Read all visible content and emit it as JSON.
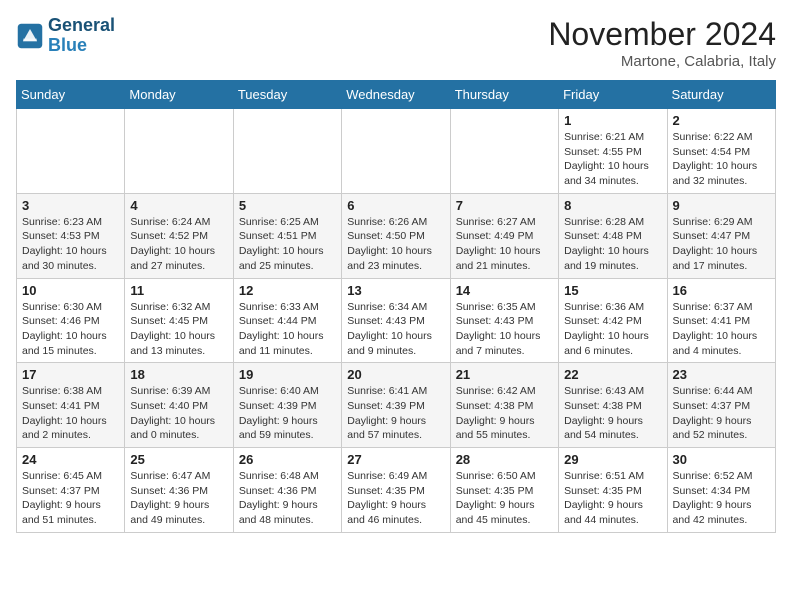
{
  "logo": {
    "line1": "General",
    "line2": "Blue"
  },
  "title": "November 2024",
  "location": "Martone, Calabria, Italy",
  "days_of_week": [
    "Sunday",
    "Monday",
    "Tuesday",
    "Wednesday",
    "Thursday",
    "Friday",
    "Saturday"
  ],
  "weeks": [
    [
      {
        "day": "",
        "info": ""
      },
      {
        "day": "",
        "info": ""
      },
      {
        "day": "",
        "info": ""
      },
      {
        "day": "",
        "info": ""
      },
      {
        "day": "",
        "info": ""
      },
      {
        "day": "1",
        "info": "Sunrise: 6:21 AM\nSunset: 4:55 PM\nDaylight: 10 hours and 34 minutes."
      },
      {
        "day": "2",
        "info": "Sunrise: 6:22 AM\nSunset: 4:54 PM\nDaylight: 10 hours and 32 minutes."
      }
    ],
    [
      {
        "day": "3",
        "info": "Sunrise: 6:23 AM\nSunset: 4:53 PM\nDaylight: 10 hours and 30 minutes."
      },
      {
        "day": "4",
        "info": "Sunrise: 6:24 AM\nSunset: 4:52 PM\nDaylight: 10 hours and 27 minutes."
      },
      {
        "day": "5",
        "info": "Sunrise: 6:25 AM\nSunset: 4:51 PM\nDaylight: 10 hours and 25 minutes."
      },
      {
        "day": "6",
        "info": "Sunrise: 6:26 AM\nSunset: 4:50 PM\nDaylight: 10 hours and 23 minutes."
      },
      {
        "day": "7",
        "info": "Sunrise: 6:27 AM\nSunset: 4:49 PM\nDaylight: 10 hours and 21 minutes."
      },
      {
        "day": "8",
        "info": "Sunrise: 6:28 AM\nSunset: 4:48 PM\nDaylight: 10 hours and 19 minutes."
      },
      {
        "day": "9",
        "info": "Sunrise: 6:29 AM\nSunset: 4:47 PM\nDaylight: 10 hours and 17 minutes."
      }
    ],
    [
      {
        "day": "10",
        "info": "Sunrise: 6:30 AM\nSunset: 4:46 PM\nDaylight: 10 hours and 15 minutes."
      },
      {
        "day": "11",
        "info": "Sunrise: 6:32 AM\nSunset: 4:45 PM\nDaylight: 10 hours and 13 minutes."
      },
      {
        "day": "12",
        "info": "Sunrise: 6:33 AM\nSunset: 4:44 PM\nDaylight: 10 hours and 11 minutes."
      },
      {
        "day": "13",
        "info": "Sunrise: 6:34 AM\nSunset: 4:43 PM\nDaylight: 10 hours and 9 minutes."
      },
      {
        "day": "14",
        "info": "Sunrise: 6:35 AM\nSunset: 4:43 PM\nDaylight: 10 hours and 7 minutes."
      },
      {
        "day": "15",
        "info": "Sunrise: 6:36 AM\nSunset: 4:42 PM\nDaylight: 10 hours and 6 minutes."
      },
      {
        "day": "16",
        "info": "Sunrise: 6:37 AM\nSunset: 4:41 PM\nDaylight: 10 hours and 4 minutes."
      }
    ],
    [
      {
        "day": "17",
        "info": "Sunrise: 6:38 AM\nSunset: 4:41 PM\nDaylight: 10 hours and 2 minutes."
      },
      {
        "day": "18",
        "info": "Sunrise: 6:39 AM\nSunset: 4:40 PM\nDaylight: 10 hours and 0 minutes."
      },
      {
        "day": "19",
        "info": "Sunrise: 6:40 AM\nSunset: 4:39 PM\nDaylight: 9 hours and 59 minutes."
      },
      {
        "day": "20",
        "info": "Sunrise: 6:41 AM\nSunset: 4:39 PM\nDaylight: 9 hours and 57 minutes."
      },
      {
        "day": "21",
        "info": "Sunrise: 6:42 AM\nSunset: 4:38 PM\nDaylight: 9 hours and 55 minutes."
      },
      {
        "day": "22",
        "info": "Sunrise: 6:43 AM\nSunset: 4:38 PM\nDaylight: 9 hours and 54 minutes."
      },
      {
        "day": "23",
        "info": "Sunrise: 6:44 AM\nSunset: 4:37 PM\nDaylight: 9 hours and 52 minutes."
      }
    ],
    [
      {
        "day": "24",
        "info": "Sunrise: 6:45 AM\nSunset: 4:37 PM\nDaylight: 9 hours and 51 minutes."
      },
      {
        "day": "25",
        "info": "Sunrise: 6:47 AM\nSunset: 4:36 PM\nDaylight: 9 hours and 49 minutes."
      },
      {
        "day": "26",
        "info": "Sunrise: 6:48 AM\nSunset: 4:36 PM\nDaylight: 9 hours and 48 minutes."
      },
      {
        "day": "27",
        "info": "Sunrise: 6:49 AM\nSunset: 4:35 PM\nDaylight: 9 hours and 46 minutes."
      },
      {
        "day": "28",
        "info": "Sunrise: 6:50 AM\nSunset: 4:35 PM\nDaylight: 9 hours and 45 minutes."
      },
      {
        "day": "29",
        "info": "Sunrise: 6:51 AM\nSunset: 4:35 PM\nDaylight: 9 hours and 44 minutes."
      },
      {
        "day": "30",
        "info": "Sunrise: 6:52 AM\nSunset: 4:34 PM\nDaylight: 9 hours and 42 minutes."
      }
    ]
  ]
}
